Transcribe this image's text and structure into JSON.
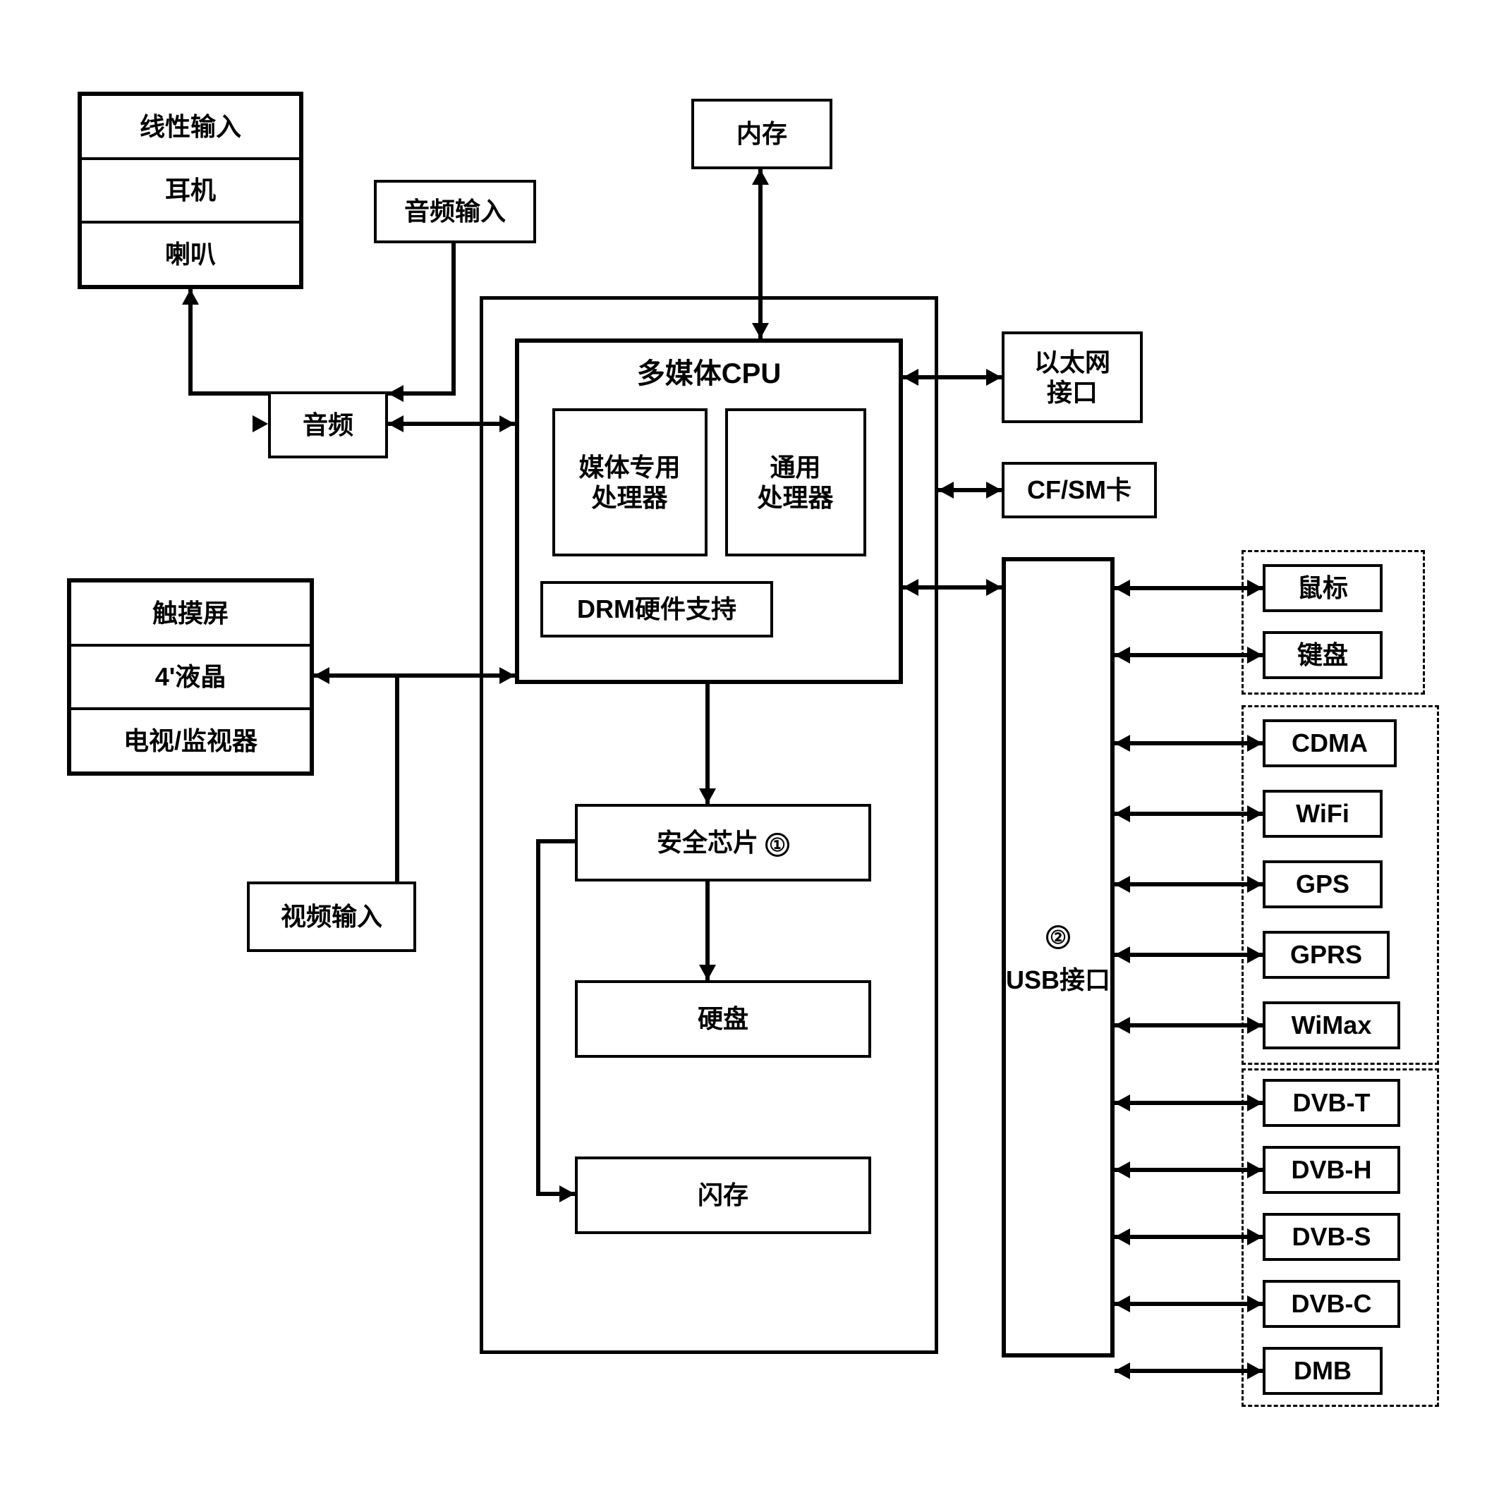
{
  "audio_outputs": {
    "linear": "线性输入",
    "headphone": "耳机",
    "speaker": "喇叭"
  },
  "audio_input": "音频输入",
  "memory": "内存",
  "audio": "音频",
  "cpu": {
    "title": "多媒体CPU",
    "media_proc": "媒体专用\n处理器",
    "gen_proc": "通用\n处理器",
    "drm": "DRM硬件支持"
  },
  "ethernet": "以太网\n接口",
  "cfsm": "CF/SM卡",
  "video_outputs": {
    "touch": "触摸屏",
    "lcd": "4'液晶",
    "tv": "电视/监视器"
  },
  "video_input": "视频输入",
  "security": {
    "label": "安全芯片",
    "mark": "①"
  },
  "hdd": "硬盘",
  "flash": "闪存",
  "usb": {
    "label": "USB接口",
    "mark": "②"
  },
  "peripherals": {
    "group1": [
      "鼠标",
      "键盘"
    ],
    "group2": [
      "CDMA",
      "WiFi",
      "GPS",
      "GPRS",
      "WiMax"
    ],
    "group3": [
      "DVB-T",
      "DVB-H",
      "DVB-S",
      "DVB-C",
      "DMB"
    ]
  }
}
